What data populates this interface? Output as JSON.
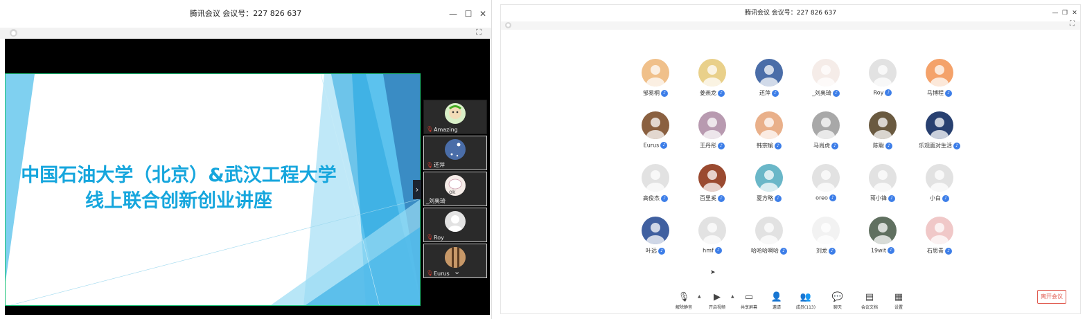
{
  "left_window": {
    "title": "腾讯会议 会议号：227 826 637",
    "controls": {
      "minimize": "—",
      "maximize": "☐",
      "close": "✕"
    },
    "slide_title": "中国石油大学（北京）&武汉工程大学线上联合创新创业讲座",
    "participants": [
      {
        "name": "Amazing",
        "avatar": "cartoon-avatar",
        "muted": true,
        "selected": false
      },
      {
        "name": "还萍",
        "avatar": "night-moon-avatar",
        "muted": true,
        "selected": true
      },
      {
        "name": "_刘奥琦",
        "avatar": "ok-bunny-avatar",
        "muted": false,
        "selected": true
      },
      {
        "name": "Roy",
        "avatar": "default-avatar",
        "muted": true,
        "selected": true
      },
      {
        "name": "Eurus",
        "avatar": "sunset-avatar",
        "muted": true,
        "selected": true
      }
    ]
  },
  "right_window": {
    "title": "腾讯会议 会议号：227 826 637",
    "participants": [
      {
        "name": "邹易桐",
        "color": "#f0c08a"
      },
      {
        "name": "姜燕龙",
        "color": "#e9d08a"
      },
      {
        "name": "还萍",
        "color": "#4a6da8"
      },
      {
        "name": "_刘奥琦",
        "color": "#f5ece8"
      },
      {
        "name": "Roy",
        "color": "#e2e2e2"
      },
      {
        "name": "马博程",
        "color": "#f4a26a"
      },
      {
        "name": "Eurus",
        "color": "#8a6040"
      },
      {
        "name": "王丹彤",
        "color": "#b89ab0"
      },
      {
        "name": "韩宗瑜",
        "color": "#e9b08a"
      },
      {
        "name": "马尚虎",
        "color": "#a8a8a8"
      },
      {
        "name": "陈聪",
        "color": "#6a5a40"
      },
      {
        "name": "乐观面对生活",
        "color": "#284070"
      },
      {
        "name": "高俊杰",
        "color": "#e2e2e2"
      },
      {
        "name": "百里奚",
        "color": "#9a4a30"
      },
      {
        "name": "夏方略",
        "color": "#6ab7c8"
      },
      {
        "name": "oreo",
        "color": "#e2e2e2"
      },
      {
        "name": "蒋小锋",
        "color": "#e2e2e2"
      },
      {
        "name": "小白",
        "color": "#e2e2e2"
      },
      {
        "name": "叶远",
        "color": "#4060a0"
      },
      {
        "name": "hmf",
        "color": "#e2e2e2"
      },
      {
        "name": "哈哈哈啊哈",
        "color": "#e2e2e2"
      },
      {
        "name": "刘龙",
        "color": "#f2f2f2"
      },
      {
        "name": "19wit",
        "color": "#607060"
      },
      {
        "name": "石思青",
        "color": "#f0c8c8"
      }
    ],
    "toolbar": [
      {
        "label": "解除静音",
        "icon": "mic-muted-icon"
      },
      {
        "label": "开启视频",
        "icon": "camera-off-icon"
      },
      {
        "label": "共享屏幕",
        "icon": "share-screen-icon"
      },
      {
        "label": "邀请",
        "icon": "invite-icon"
      },
      {
        "label": "成员(113)",
        "icon": "members-icon"
      },
      {
        "label": "聊天",
        "icon": "chat-icon"
      },
      {
        "label": "会议文档",
        "icon": "document-icon"
      },
      {
        "label": "设置",
        "icon": "settings-icon"
      }
    ],
    "leave_button": "离开会议"
  }
}
